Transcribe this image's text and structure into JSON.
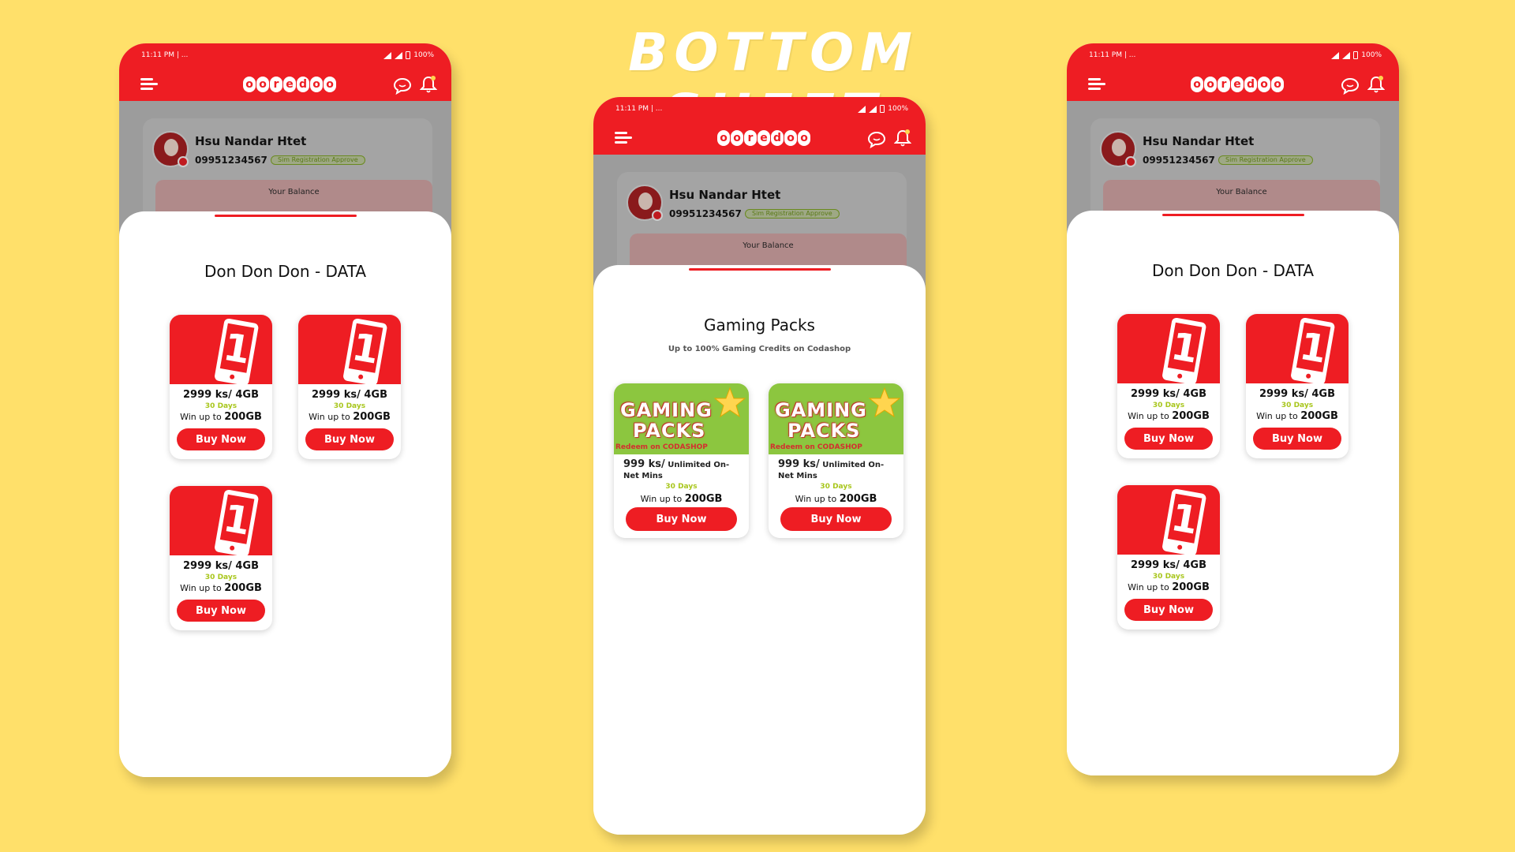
{
  "headline": "BOTTOM SHEET",
  "status": {
    "time": "11:11 PM | ...",
    "battery": "100%"
  },
  "brand": {
    "logo_letters": [
      "o",
      "o",
      "r",
      "e",
      "d",
      "o",
      "o"
    ]
  },
  "profile": {
    "name": "Hsu Nandar Htet",
    "number": "09951234567",
    "badge": "Sim Registration Approve",
    "balance_label": "Your Balance"
  },
  "data_sheet": {
    "title": "Don Don Don - DATA",
    "packs": [
      {
        "price": "2999 ks/ 4GB",
        "days": "30 Days",
        "win_prefix": "Win up to",
        "win_amount": "200GB",
        "button": "Buy Now"
      },
      {
        "price": "2999 ks/ 4GB",
        "days": "30 Days",
        "win_prefix": "Win up to",
        "win_amount": "200GB",
        "button": "Buy Now"
      },
      {
        "price": "2999 ks/ 4GB",
        "days": "30 Days",
        "win_prefix": "Win up to",
        "win_amount": "200GB",
        "button": "Buy Now"
      }
    ]
  },
  "gaming_sheet": {
    "title": "Gaming Packs",
    "subtitle": "Up to 100% Gaming Credits on Codashop",
    "image_line1": "GAMING",
    "image_line2": "PACKS",
    "image_sub": "Redeem on CODASHOP",
    "packs": [
      {
        "price": "999 ks/",
        "desc": "Unlimited On-Net Mins",
        "days": "30 Days",
        "win_prefix": "Win up to",
        "win_amount": "200GB",
        "button": "Buy Now"
      },
      {
        "price": "999 ks/",
        "desc": "Unlimited On-Net Mins",
        "days": "30 Days",
        "win_prefix": "Win up to",
        "win_amount": "200GB",
        "button": "Buy Now"
      }
    ]
  },
  "colors": {
    "background": "#FFE06A",
    "brand_red": "#EE1D23",
    "accent_green": "#A8C61C"
  }
}
